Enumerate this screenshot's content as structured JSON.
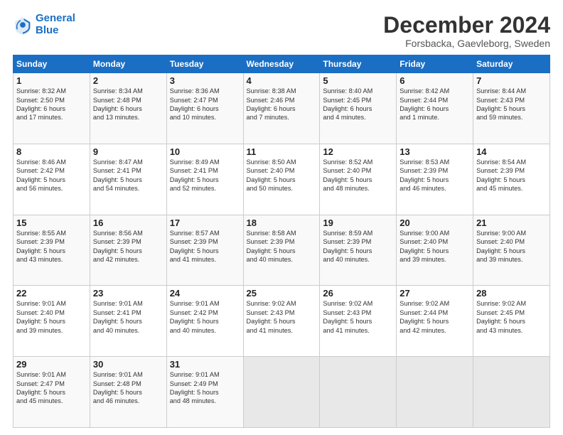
{
  "header": {
    "logo_line1": "General",
    "logo_line2": "Blue",
    "title": "December 2024",
    "subtitle": "Forsbacka, Gaevleborg, Sweden"
  },
  "days_of_week": [
    "Sunday",
    "Monday",
    "Tuesday",
    "Wednesday",
    "Thursday",
    "Friday",
    "Saturday"
  ],
  "weeks": [
    [
      {
        "day": "1",
        "info": "Sunrise: 8:32 AM\nSunset: 2:50 PM\nDaylight: 6 hours\nand 17 minutes."
      },
      {
        "day": "2",
        "info": "Sunrise: 8:34 AM\nSunset: 2:48 PM\nDaylight: 6 hours\nand 13 minutes."
      },
      {
        "day": "3",
        "info": "Sunrise: 8:36 AM\nSunset: 2:47 PM\nDaylight: 6 hours\nand 10 minutes."
      },
      {
        "day": "4",
        "info": "Sunrise: 8:38 AM\nSunset: 2:46 PM\nDaylight: 6 hours\nand 7 minutes."
      },
      {
        "day": "5",
        "info": "Sunrise: 8:40 AM\nSunset: 2:45 PM\nDaylight: 6 hours\nand 4 minutes."
      },
      {
        "day": "6",
        "info": "Sunrise: 8:42 AM\nSunset: 2:44 PM\nDaylight: 6 hours\nand 1 minute."
      },
      {
        "day": "7",
        "info": "Sunrise: 8:44 AM\nSunset: 2:43 PM\nDaylight: 5 hours\nand 59 minutes."
      }
    ],
    [
      {
        "day": "8",
        "info": "Sunrise: 8:46 AM\nSunset: 2:42 PM\nDaylight: 5 hours\nand 56 minutes."
      },
      {
        "day": "9",
        "info": "Sunrise: 8:47 AM\nSunset: 2:41 PM\nDaylight: 5 hours\nand 54 minutes."
      },
      {
        "day": "10",
        "info": "Sunrise: 8:49 AM\nSunset: 2:41 PM\nDaylight: 5 hours\nand 52 minutes."
      },
      {
        "day": "11",
        "info": "Sunrise: 8:50 AM\nSunset: 2:40 PM\nDaylight: 5 hours\nand 50 minutes."
      },
      {
        "day": "12",
        "info": "Sunrise: 8:52 AM\nSunset: 2:40 PM\nDaylight: 5 hours\nand 48 minutes."
      },
      {
        "day": "13",
        "info": "Sunrise: 8:53 AM\nSunset: 2:39 PM\nDaylight: 5 hours\nand 46 minutes."
      },
      {
        "day": "14",
        "info": "Sunrise: 8:54 AM\nSunset: 2:39 PM\nDaylight: 5 hours\nand 45 minutes."
      }
    ],
    [
      {
        "day": "15",
        "info": "Sunrise: 8:55 AM\nSunset: 2:39 PM\nDaylight: 5 hours\nand 43 minutes."
      },
      {
        "day": "16",
        "info": "Sunrise: 8:56 AM\nSunset: 2:39 PM\nDaylight: 5 hours\nand 42 minutes."
      },
      {
        "day": "17",
        "info": "Sunrise: 8:57 AM\nSunset: 2:39 PM\nDaylight: 5 hours\nand 41 minutes."
      },
      {
        "day": "18",
        "info": "Sunrise: 8:58 AM\nSunset: 2:39 PM\nDaylight: 5 hours\nand 40 minutes."
      },
      {
        "day": "19",
        "info": "Sunrise: 8:59 AM\nSunset: 2:39 PM\nDaylight: 5 hours\nand 40 minutes."
      },
      {
        "day": "20",
        "info": "Sunrise: 9:00 AM\nSunset: 2:40 PM\nDaylight: 5 hours\nand 39 minutes."
      },
      {
        "day": "21",
        "info": "Sunrise: 9:00 AM\nSunset: 2:40 PM\nDaylight: 5 hours\nand 39 minutes."
      }
    ],
    [
      {
        "day": "22",
        "info": "Sunrise: 9:01 AM\nSunset: 2:40 PM\nDaylight: 5 hours\nand 39 minutes."
      },
      {
        "day": "23",
        "info": "Sunrise: 9:01 AM\nSunset: 2:41 PM\nDaylight: 5 hours\nand 40 minutes."
      },
      {
        "day": "24",
        "info": "Sunrise: 9:01 AM\nSunset: 2:42 PM\nDaylight: 5 hours\nand 40 minutes."
      },
      {
        "day": "25",
        "info": "Sunrise: 9:02 AM\nSunset: 2:43 PM\nDaylight: 5 hours\nand 41 minutes."
      },
      {
        "day": "26",
        "info": "Sunrise: 9:02 AM\nSunset: 2:43 PM\nDaylight: 5 hours\nand 41 minutes."
      },
      {
        "day": "27",
        "info": "Sunrise: 9:02 AM\nSunset: 2:44 PM\nDaylight: 5 hours\nand 42 minutes."
      },
      {
        "day": "28",
        "info": "Sunrise: 9:02 AM\nSunset: 2:45 PM\nDaylight: 5 hours\nand 43 minutes."
      }
    ],
    [
      {
        "day": "29",
        "info": "Sunrise: 9:01 AM\nSunset: 2:47 PM\nDaylight: 5 hours\nand 45 minutes."
      },
      {
        "day": "30",
        "info": "Sunrise: 9:01 AM\nSunset: 2:48 PM\nDaylight: 5 hours\nand 46 minutes."
      },
      {
        "day": "31",
        "info": "Sunrise: 9:01 AM\nSunset: 2:49 PM\nDaylight: 5 hours\nand 48 minutes."
      },
      {
        "day": "",
        "info": ""
      },
      {
        "day": "",
        "info": ""
      },
      {
        "day": "",
        "info": ""
      },
      {
        "day": "",
        "info": ""
      }
    ]
  ]
}
